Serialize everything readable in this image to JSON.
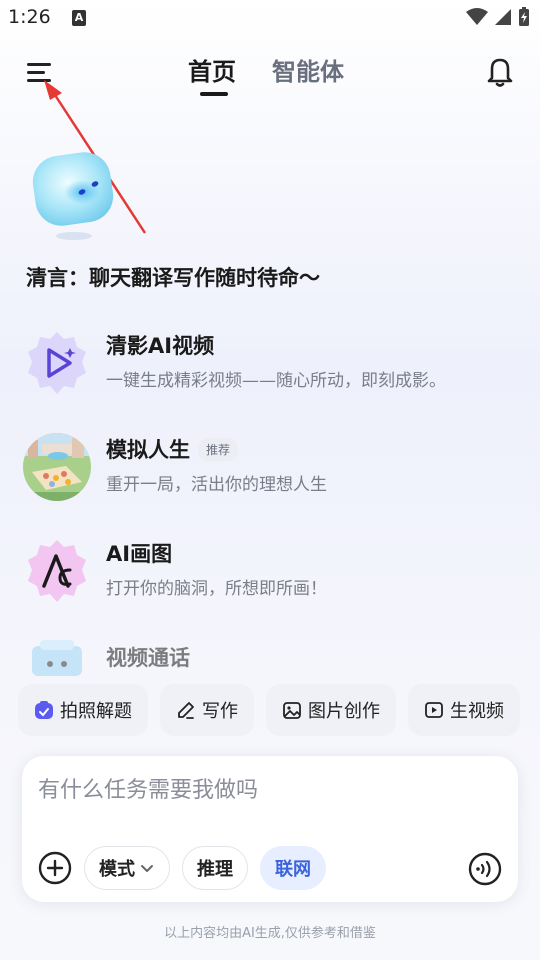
{
  "status_bar": {
    "time": "1:26",
    "notification_letter": "A",
    "icons": [
      "wifi-icon",
      "signal-icon",
      "battery-charging-icon"
    ]
  },
  "header": {
    "tabs": [
      {
        "label": "首页",
        "active": true
      },
      {
        "label": "智能体",
        "active": false
      }
    ],
    "menu_icon": "hamburger-menu-icon",
    "bell_icon": "bell-icon"
  },
  "greeting": "清言：聊天翻译写作随时待命～",
  "agents": [
    {
      "title": "清影AI视频",
      "desc": "一键生成精彩视频——随心所动，即刻成影。",
      "icon": "video-play-icon",
      "badge": ""
    },
    {
      "title": "模拟人生",
      "desc": "重开一局，活出你的理想人生",
      "icon": "life-sim-thumbnail",
      "badge": "推荐"
    },
    {
      "title": "AI画图",
      "desc": "打开你的脑洞，所想即所画！",
      "icon": "ai-draw-icon",
      "badge": ""
    },
    {
      "title": "视频通话",
      "desc": "",
      "icon": "video-call-icon",
      "badge": ""
    }
  ],
  "quick_actions": [
    {
      "label": "拍照解题",
      "icon": "photo-solve-icon"
    },
    {
      "label": "写作",
      "icon": "pen-icon"
    },
    {
      "label": "图片创作",
      "icon": "image-create-icon"
    },
    {
      "label": "生视频",
      "icon": "video-generate-icon"
    }
  ],
  "composer": {
    "placeholder": "有什么任务需要我做吗",
    "mode_label": "模式",
    "reason_label": "推理",
    "web_label": "联网"
  },
  "footer_note": "以上内容均由AI生成,仅供参考和借鉴",
  "colors": {
    "accent_blue": "#3b63e0",
    "arrow_red": "#e53935",
    "agent_purple": "#6a55e0"
  }
}
